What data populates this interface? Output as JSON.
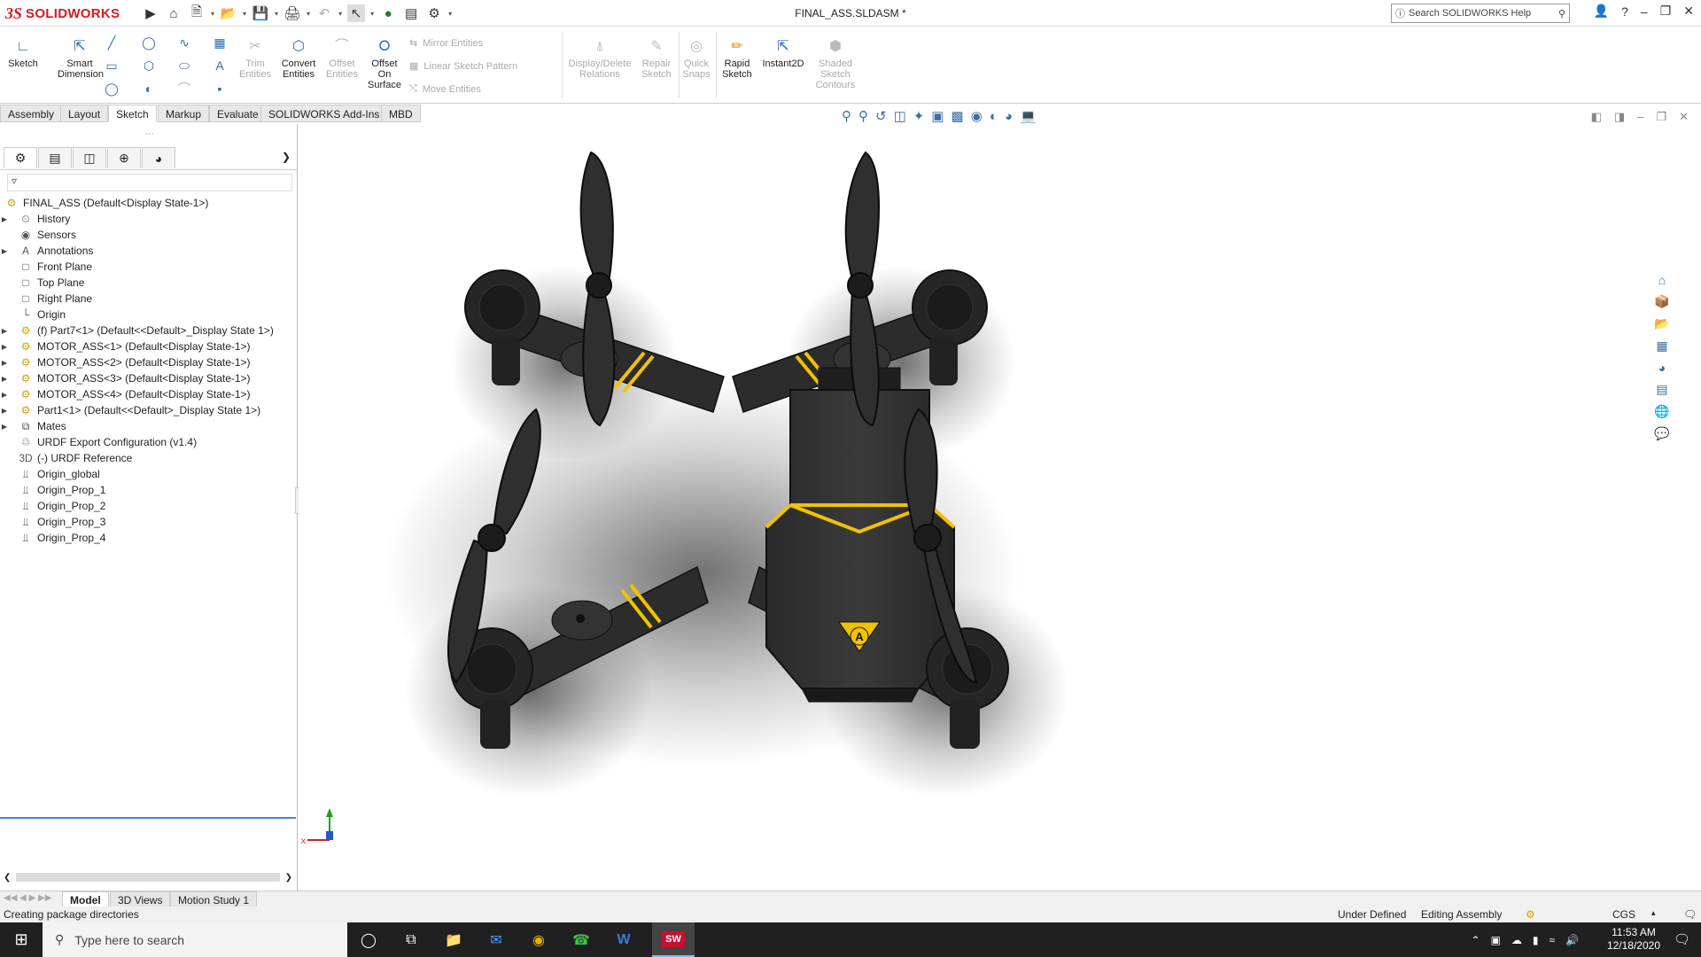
{
  "app": {
    "logo_mark": "3S",
    "logo_text": "SOLIDWORKS",
    "document_title": "FINAL_ASS.SLDASM *",
    "help_search_placeholder": "Search SOLIDWORKS Help"
  },
  "commands": {
    "sketch": "Sketch",
    "smart_dimension": "Smart Dimension",
    "trim_entities": "Trim Entities",
    "convert_entities": "Convert Entities",
    "offset_entities": "Offset Entities",
    "offset_on_surface": "Offset On Surface",
    "mirror_entities": "Mirror Entities",
    "linear_sketch_pattern": "Linear Sketch Pattern",
    "move_entities": "Move Entities",
    "display_delete_relations": "Display/Delete Relations",
    "repair_sketch": "Repair Sketch",
    "quick_snaps": "Quick Snaps",
    "rapid_sketch": "Rapid Sketch",
    "instant2d": "Instant2D",
    "shaded_sketch_contours": "Shaded Sketch Contours"
  },
  "tabs": [
    "Assembly",
    "Layout",
    "Sketch",
    "Markup",
    "Evaluate",
    "SOLIDWORKS Add-Ins",
    "MBD"
  ],
  "active_tab": "Sketch",
  "tree": {
    "root": "FINAL_ASS  (Default<Display State-1>)",
    "items": [
      {
        "label": "History",
        "icon": "history-icon",
        "expandable": true
      },
      {
        "label": "Sensors",
        "icon": "sensor-icon",
        "expandable": false
      },
      {
        "label": "Annotations",
        "icon": "annotation-icon",
        "expandable": true
      },
      {
        "label": "Front Plane",
        "icon": "plane-icon",
        "expandable": false
      },
      {
        "label": "Top Plane",
        "icon": "plane-icon",
        "expandable": false
      },
      {
        "label": "Right Plane",
        "icon": "plane-icon",
        "expandable": false
      },
      {
        "label": "Origin",
        "icon": "origin-icon",
        "expandable": false
      },
      {
        "label": "(f) Part7<1> (Default<<Default>_Display State 1>)",
        "icon": "part-icon",
        "expandable": true
      },
      {
        "label": "MOTOR_ASS<1> (Default<Display State-1>)",
        "icon": "assembly-icon",
        "expandable": true
      },
      {
        "label": "MOTOR_ASS<2> (Default<Display State-1>)",
        "icon": "assembly-icon",
        "expandable": true
      },
      {
        "label": "MOTOR_ASS<3> (Default<Display State-1>)",
        "icon": "assembly-icon",
        "expandable": true
      },
      {
        "label": "MOTOR_ASS<4> (Default<Display State-1>)",
        "icon": "assembly-icon",
        "expandable": true
      },
      {
        "label": "Part1<1> (Default<<Default>_Display State 1>)",
        "icon": "part-icon",
        "expandable": true
      },
      {
        "label": "Mates",
        "icon": "mates-icon",
        "expandable": true
      },
      {
        "label": "URDF Export Configuration (v1.4)",
        "icon": "config-icon",
        "expandable": false
      },
      {
        "label": "(-) URDF Reference",
        "icon": "reference-3d-icon",
        "expandable": false
      },
      {
        "label": "Origin_global",
        "icon": "coordinate-system-icon",
        "expandable": false
      },
      {
        "label": "Origin_Prop_1",
        "icon": "coordinate-system-icon",
        "expandable": false
      },
      {
        "label": "Origin_Prop_2",
        "icon": "coordinate-system-icon",
        "expandable": false
      },
      {
        "label": "Origin_Prop_3",
        "icon": "coordinate-system-icon",
        "expandable": false
      },
      {
        "label": "Origin_Prop_4",
        "icon": "coordinate-system-icon",
        "expandable": false
      }
    ]
  },
  "bottom_tabs": [
    "Model",
    "3D Views",
    "Motion Study 1"
  ],
  "active_bottom_tab": "Model",
  "status": {
    "message": "Creating package directories",
    "sketch_state": "Under Defined",
    "mode": "Editing Assembly",
    "units": "CGS"
  },
  "taskbar": {
    "search_placeholder": "Type here to search",
    "time": "11:53 AM",
    "date": "12/18/2020",
    "solidworks_badge": "SW"
  },
  "colors": {
    "brand_red": "#d71920",
    "accent_blue": "#3b86d1",
    "drone_body": "#2a2a2a",
    "drone_stripe": "#f2c200"
  }
}
